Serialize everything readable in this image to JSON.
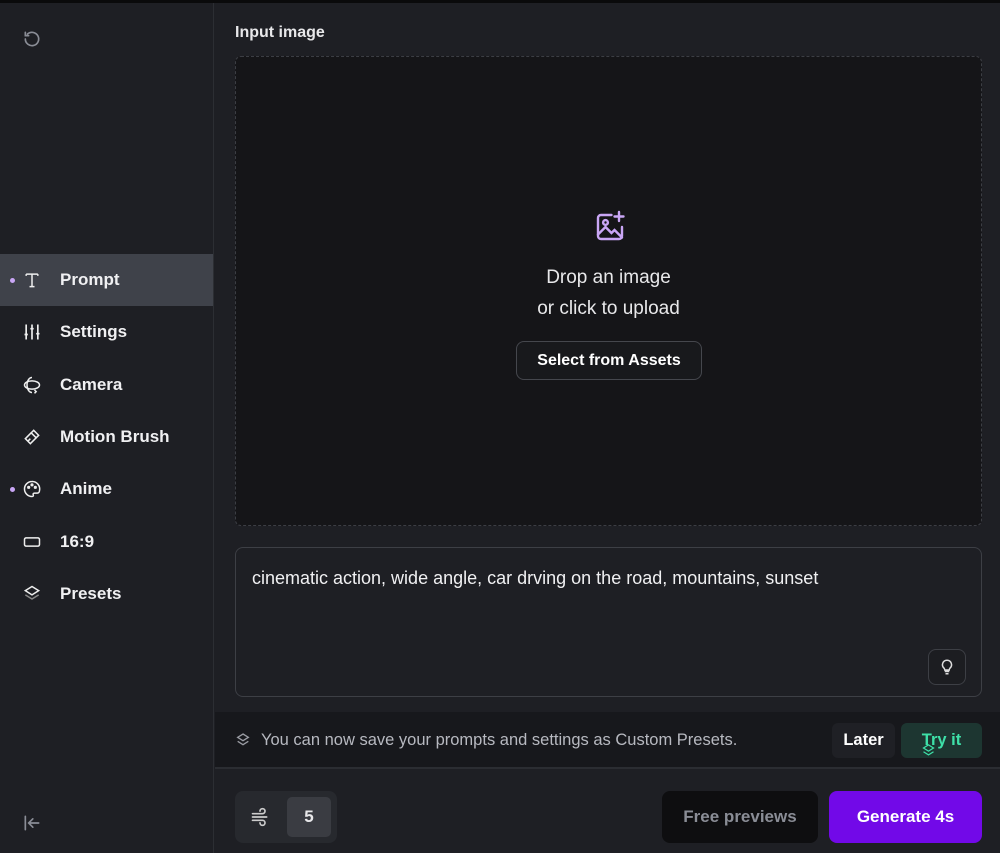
{
  "sidebar": {
    "items": [
      {
        "label": "Prompt",
        "icon": "text-icon",
        "active": true,
        "dot": true
      },
      {
        "label": "Settings",
        "icon": "sliders-icon"
      },
      {
        "label": "Camera",
        "icon": "camera-orbit-icon"
      },
      {
        "label": "Motion Brush",
        "icon": "brush-icon"
      },
      {
        "label": "Anime",
        "icon": "palette-icon",
        "dot": true
      },
      {
        "label": "16:9",
        "icon": "aspect-ratio-icon"
      },
      {
        "label": "Presets",
        "icon": "layers-icon"
      }
    ]
  },
  "main": {
    "title": "Input image",
    "drop_line1": "Drop an image",
    "drop_line2": "or click to upload",
    "select_assets": "Select from Assets",
    "prompt_value": "cinematic action, wide angle, car drving on the road, mountains, sunset"
  },
  "banner": {
    "message": "You can now save your prompts and settings as Custom Presets.",
    "later": "Later",
    "try": "Try it"
  },
  "footer": {
    "count": "5",
    "free_previews": "Free previews",
    "generate": "Generate 4s"
  },
  "colors": {
    "accent": "#7209e8",
    "try_green": "#3ee0a8",
    "dot": "#c9a6f5"
  }
}
